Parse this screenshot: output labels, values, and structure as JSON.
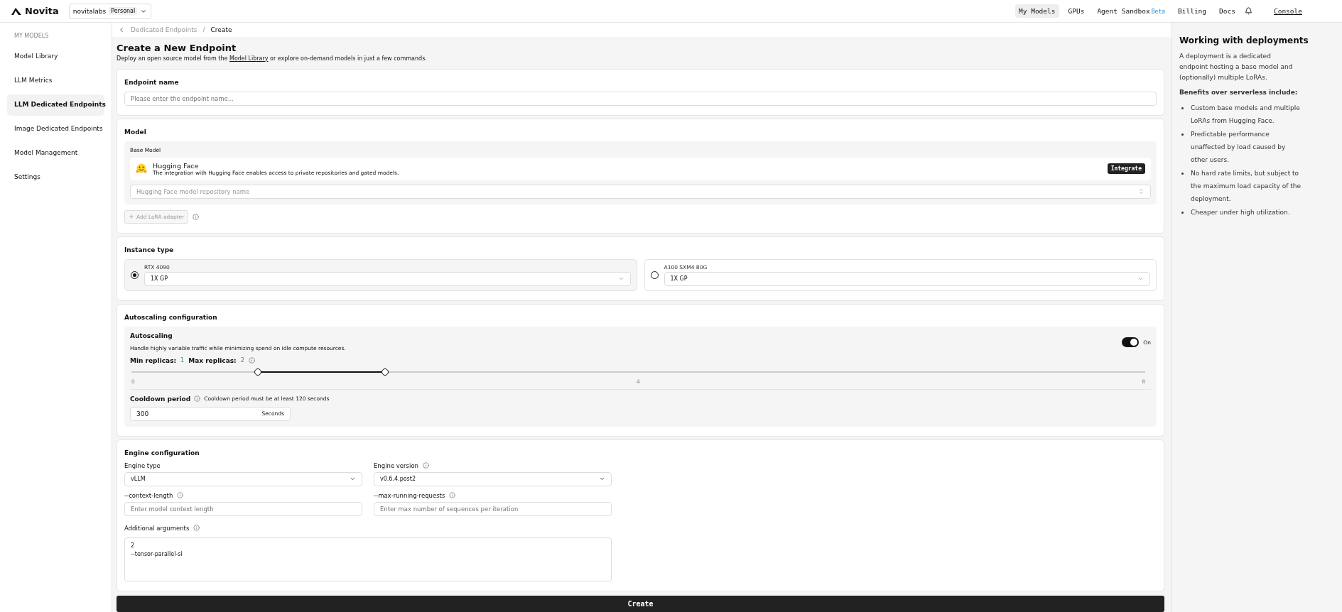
{
  "topbar": {
    "brand": "Novita",
    "workspace": {
      "name": "novitalabs",
      "badge": "Personal"
    },
    "nav": [
      {
        "label": "My Models",
        "selected": true
      },
      {
        "label": "GPUs",
        "selected": false
      },
      {
        "label": "Agent Sandbox",
        "badge": "Beta",
        "selected": false
      },
      {
        "label": "Billing",
        "selected": false
      },
      {
        "label": "Docs",
        "selected": false
      }
    ],
    "console": "Console"
  },
  "sidebar": {
    "heading": "MY MODELS",
    "items": [
      {
        "label": "Model Library",
        "selected": false
      },
      {
        "label": "LLM Metrics",
        "selected": false
      },
      {
        "label": "LLM Dedicated Endpoints",
        "selected": true
      },
      {
        "label": "Image Dedicated Endpoints",
        "selected": false
      },
      {
        "label": "Model Management",
        "selected": false
      },
      {
        "label": "Settings",
        "selected": false
      }
    ]
  },
  "breadcrumb": [
    "Dedicated Endpoints",
    "/",
    "Create"
  ],
  "header": {
    "title": "Create a New Endpoint",
    "intro_before": "Deploy an open source model from the",
    "intro_link": "Model Library",
    "intro_after": "or explore on-demand models in just a few commands."
  },
  "endpoint_name": {
    "label": "Endpoint name",
    "placeholder": "Please enter the endpoint name..."
  },
  "model": {
    "label": "Model",
    "base_label": "Base Model",
    "provider": "Hugging Face",
    "provider_desc": "The integration with Hugging Face enables access to private repositories and gated models.",
    "integrate": "Integrate",
    "repo_placeholder": "Hugging Face model repository name",
    "add_lora": "Add LoRA adapter"
  },
  "instance": {
    "label": "Instance type",
    "options": [
      {
        "name": "RTX 4090",
        "value": "1X GP",
        "selected": true
      },
      {
        "name": "A100 SXM4 80G",
        "value": "1X GP",
        "selected": false
      }
    ]
  },
  "autoscaling": {
    "label": "Autoscaling configuration",
    "title": "Autoscaling",
    "desc": "Handle highly variable traffic while minimizing spend on idle compute resources.",
    "on": true,
    "on_label": "On",
    "min_label": "Min replicas:",
    "min_value": "1",
    "max_label": "Max replicas:",
    "max_value": "2",
    "low": {
      "level": 0.125
    },
    "high": {
      "level": 0.25
    },
    "ticks": [
      "0",
      "4",
      "8"
    ],
    "cooldown_label": "Cooldown period",
    "cooldown_hint": "Cooldown period must be at least 120 seconds",
    "cooldown_value": "300",
    "cooldown_unit": "Seconds"
  },
  "engine": {
    "label": "Engine configuration",
    "type_label": "Engine type",
    "type_value": "vLLM",
    "version_label": "Engine version",
    "version_value": "v0.6.4.post2",
    "context_label": "--context-length",
    "context_placeholder": "Enter model context length",
    "max_label": "--max-running-requests",
    "max_placeholder": "Enter max number of sequences per iteration",
    "args_label": "Additional arguments",
    "args_lines": [
      "2",
      "--tensor-parallel-si"
    ]
  },
  "create": "Create",
  "side_panel": {
    "title": "Working with deployments",
    "intro": "A deployment is a dedicated endpoint hosting a base model and (optionally) multiple LoRAs.",
    "benefits_title": "Benefits over serverless include:",
    "benefits": [
      "Custom base models and multiple LoRAs from Hugging Face.",
      "Predictable performance unaffected by load caused by other users.",
      "No hard rate limits, but subject to the maximum load capacity of the deployment.",
      "Cheaper under high utilization."
    ]
  }
}
